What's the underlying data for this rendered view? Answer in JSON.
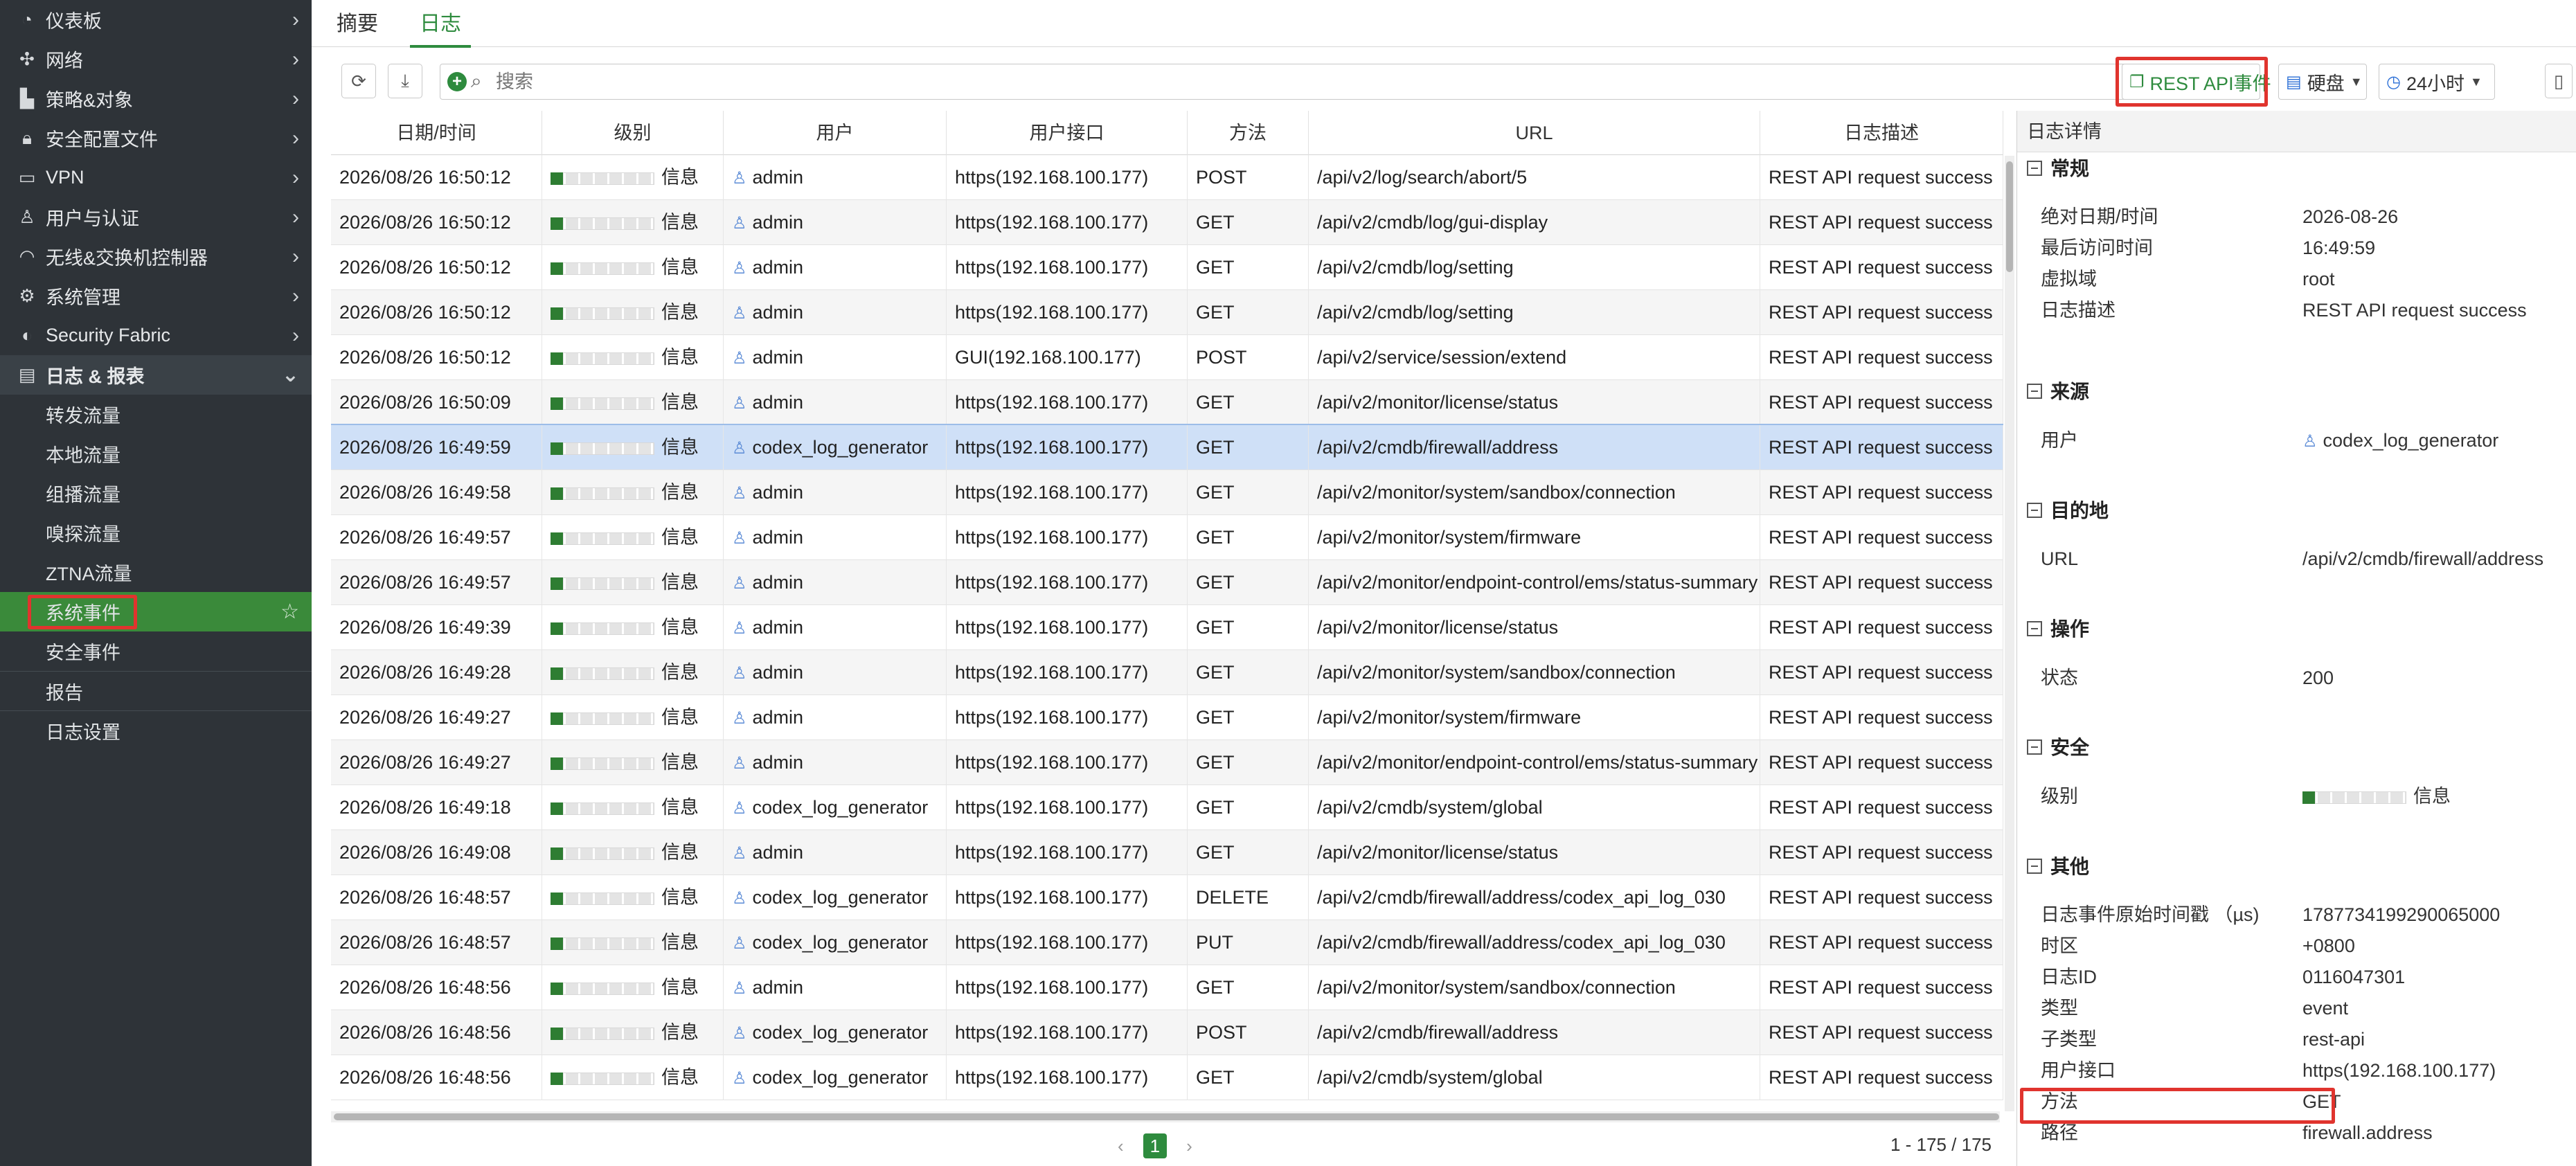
{
  "sidebar": {
    "items": [
      {
        "label": "仪表板",
        "icon": "dashboard-icon"
      },
      {
        "label": "网络",
        "icon": "network-icon"
      },
      {
        "label": "策略&对象",
        "icon": "policy-icon"
      },
      {
        "label": "安全配置文件",
        "icon": "lock-icon"
      },
      {
        "label": "VPN",
        "icon": "laptop-icon"
      },
      {
        "label": "用户与认证",
        "icon": "user-icon"
      },
      {
        "label": "无线&交换机控制器",
        "icon": "wifi-icon"
      },
      {
        "label": "系统管理",
        "icon": "gear-icon"
      },
      {
        "label": "Security Fabric",
        "icon": "fabric-icon"
      },
      {
        "label": "日志 & 报表",
        "icon": "log-icon"
      }
    ],
    "sub_items": [
      "转发流量",
      "本地流量",
      "组播流量",
      "嗅探流量",
      "ZTNA流量",
      "系统事件",
      "安全事件",
      "报告",
      "日志设置"
    ]
  },
  "tabs": [
    "摘要",
    "日志"
  ],
  "toolbar": {
    "search_placeholder": "搜索",
    "event_filter": "REST API事件",
    "storage": "硬盘",
    "time_range": "24小时"
  },
  "table": {
    "headers": [
      "日期/时间",
      "级别",
      "用户",
      "用户接口",
      "方法",
      "URL",
      "日志描述"
    ],
    "rows": [
      [
        "2026/08/26 16:50:12",
        "信息",
        "admin",
        "https(192.168.100.177)",
        "POST",
        "/api/v2/log/search/abort/5",
        "REST API request success"
      ],
      [
        "2026/08/26 16:50:12",
        "信息",
        "admin",
        "https(192.168.100.177)",
        "GET",
        "/api/v2/cmdb/log/gui-display",
        "REST API request success"
      ],
      [
        "2026/08/26 16:50:12",
        "信息",
        "admin",
        "https(192.168.100.177)",
        "GET",
        "/api/v2/cmdb/log/setting",
        "REST API request success"
      ],
      [
        "2026/08/26 16:50:12",
        "信息",
        "admin",
        "https(192.168.100.177)",
        "GET",
        "/api/v2/cmdb/log/setting",
        "REST API request success"
      ],
      [
        "2026/08/26 16:50:12",
        "信息",
        "admin",
        "GUI(192.168.100.177)",
        "POST",
        "/api/v2/service/session/extend",
        "REST API request success"
      ],
      [
        "2026/08/26 16:50:09",
        "信息",
        "admin",
        "https(192.168.100.177)",
        "GET",
        "/api/v2/monitor/license/status",
        "REST API request success"
      ],
      [
        "2026/08/26 16:49:59",
        "信息",
        "codex_log_generator",
        "https(192.168.100.177)",
        "GET",
        "/api/v2/cmdb/firewall/address",
        "REST API request success"
      ],
      [
        "2026/08/26 16:49:58",
        "信息",
        "admin",
        "https(192.168.100.177)",
        "GET",
        "/api/v2/monitor/system/sandbox/connection",
        "REST API request success"
      ],
      [
        "2026/08/26 16:49:57",
        "信息",
        "admin",
        "https(192.168.100.177)",
        "GET",
        "/api/v2/monitor/system/firmware",
        "REST API request success"
      ],
      [
        "2026/08/26 16:49:57",
        "信息",
        "admin",
        "https(192.168.100.177)",
        "GET",
        "/api/v2/monitor/endpoint-control/ems/status-summary",
        "REST API request success"
      ],
      [
        "2026/08/26 16:49:39",
        "信息",
        "admin",
        "https(192.168.100.177)",
        "GET",
        "/api/v2/monitor/license/status",
        "REST API request success"
      ],
      [
        "2026/08/26 16:49:28",
        "信息",
        "admin",
        "https(192.168.100.177)",
        "GET",
        "/api/v2/monitor/system/sandbox/connection",
        "REST API request success"
      ],
      [
        "2026/08/26 16:49:27",
        "信息",
        "admin",
        "https(192.168.100.177)",
        "GET",
        "/api/v2/monitor/system/firmware",
        "REST API request success"
      ],
      [
        "2026/08/26 16:49:27",
        "信息",
        "admin",
        "https(192.168.100.177)",
        "GET",
        "/api/v2/monitor/endpoint-control/ems/status-summary",
        "REST API request success"
      ],
      [
        "2026/08/26 16:49:18",
        "信息",
        "codex_log_generator",
        "https(192.168.100.177)",
        "GET",
        "/api/v2/cmdb/system/global",
        "REST API request success"
      ],
      [
        "2026/08/26 16:49:08",
        "信息",
        "admin",
        "https(192.168.100.177)",
        "GET",
        "/api/v2/monitor/license/status",
        "REST API request success"
      ],
      [
        "2026/08/26 16:48:57",
        "信息",
        "codex_log_generator",
        "https(192.168.100.177)",
        "DELETE",
        "/api/v2/cmdb/firewall/address/codex_api_log_030",
        "REST API request success"
      ],
      [
        "2026/08/26 16:48:57",
        "信息",
        "codex_log_generator",
        "https(192.168.100.177)",
        "PUT",
        "/api/v2/cmdb/firewall/address/codex_api_log_030",
        "REST API request success"
      ],
      [
        "2026/08/26 16:48:56",
        "信息",
        "admin",
        "https(192.168.100.177)",
        "GET",
        "/api/v2/monitor/system/sandbox/connection",
        "REST API request success"
      ],
      [
        "2026/08/26 16:48:56",
        "信息",
        "codex_log_generator",
        "https(192.168.100.177)",
        "POST",
        "/api/v2/cmdb/firewall/address",
        "REST API request success"
      ],
      [
        "2026/08/26 16:48:56",
        "信息",
        "codex_log_generator",
        "https(192.168.100.177)",
        "GET",
        "/api/v2/cmdb/system/global",
        "REST API request success"
      ]
    ],
    "selected_row": 6
  },
  "pagination": {
    "current_page": "1",
    "count": "1 - 175 / 175"
  },
  "detail": {
    "title": "日志详情",
    "sections": [
      {
        "name": "常规",
        "rows": [
          [
            "绝对日期/时间",
            "2026-08-26"
          ],
          [
            "最后访问时间",
            "16:49:59"
          ],
          [
            "虚拟域",
            "root"
          ],
          [
            "日志描述",
            "REST API request success"
          ]
        ]
      },
      {
        "name": "来源",
        "rows": [
          [
            "用户",
            "codex_log_generator"
          ]
        ]
      },
      {
        "name": "目的地",
        "rows": [
          [
            "URL",
            "/api/v2/cmdb/firewall/address"
          ]
        ]
      },
      {
        "name": "操作",
        "rows": [
          [
            "状态",
            "200"
          ]
        ]
      },
      {
        "name": "安全",
        "rows": [
          [
            "级别",
            "信息"
          ]
        ]
      },
      {
        "name": "其他",
        "rows": [
          [
            "日志事件原始时间戳 （µs)",
            "1787734199290065000"
          ],
          [
            "时区",
            "+0800"
          ],
          [
            "日志ID",
            "0116047301"
          ],
          [
            "类型",
            "event"
          ],
          [
            "子类型",
            "rest-api"
          ],
          [
            "用户接口",
            "https(192.168.100.177)"
          ],
          [
            "方法",
            "GET"
          ],
          [
            "路径",
            "firewall.address"
          ]
        ]
      }
    ]
  },
  "colors": {
    "accent": "#2e8b3e",
    "highlight": "#e0342e",
    "selected_row": "#cfe0f7",
    "sidebar_bg": "#2e3338"
  }
}
